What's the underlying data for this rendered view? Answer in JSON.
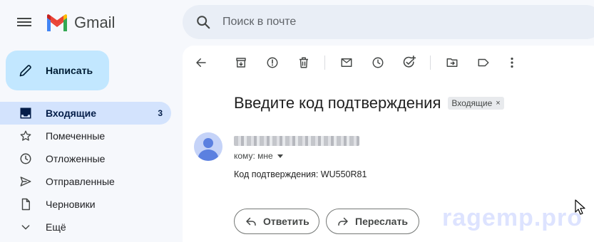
{
  "header": {
    "app_name": "Gmail",
    "search_placeholder": "Поиск в почте"
  },
  "compose": {
    "label": "Написать"
  },
  "sidebar": {
    "items": [
      {
        "label": "Входящие",
        "icon": "inbox-icon",
        "count": "3",
        "active": true
      },
      {
        "label": "Помеченные",
        "icon": "star-icon",
        "count": ""
      },
      {
        "label": "Отложенные",
        "icon": "clock-icon",
        "count": ""
      },
      {
        "label": "Отправленные",
        "icon": "send-icon",
        "count": ""
      },
      {
        "label": "Черновики",
        "icon": "draft-icon",
        "count": ""
      },
      {
        "label": "Ещё",
        "icon": "chevron-down-icon",
        "count": ""
      }
    ]
  },
  "toolbar": {
    "icons": [
      "back-icon",
      "archive-icon",
      "report-spam-icon",
      "delete-icon",
      "mark-unread-icon",
      "snooze-icon",
      "add-task-icon",
      "move-to-icon",
      "label-icon",
      "more-icon"
    ]
  },
  "message": {
    "subject": "Введите код подтверждения",
    "label_chip": "Входящие",
    "label_chip_close": "×",
    "to_line": "кому: мне",
    "body": "Код подтверждения: WU550R81"
  },
  "actions": {
    "reply": "Ответить",
    "forward": "Переслать"
  },
  "watermark": "ragemp.pro",
  "colors": {
    "background": "#f6f8fc",
    "compose_bg": "#c2e7ff",
    "active_nav": "#d3e3fd",
    "search_bg": "#e9eef6"
  }
}
